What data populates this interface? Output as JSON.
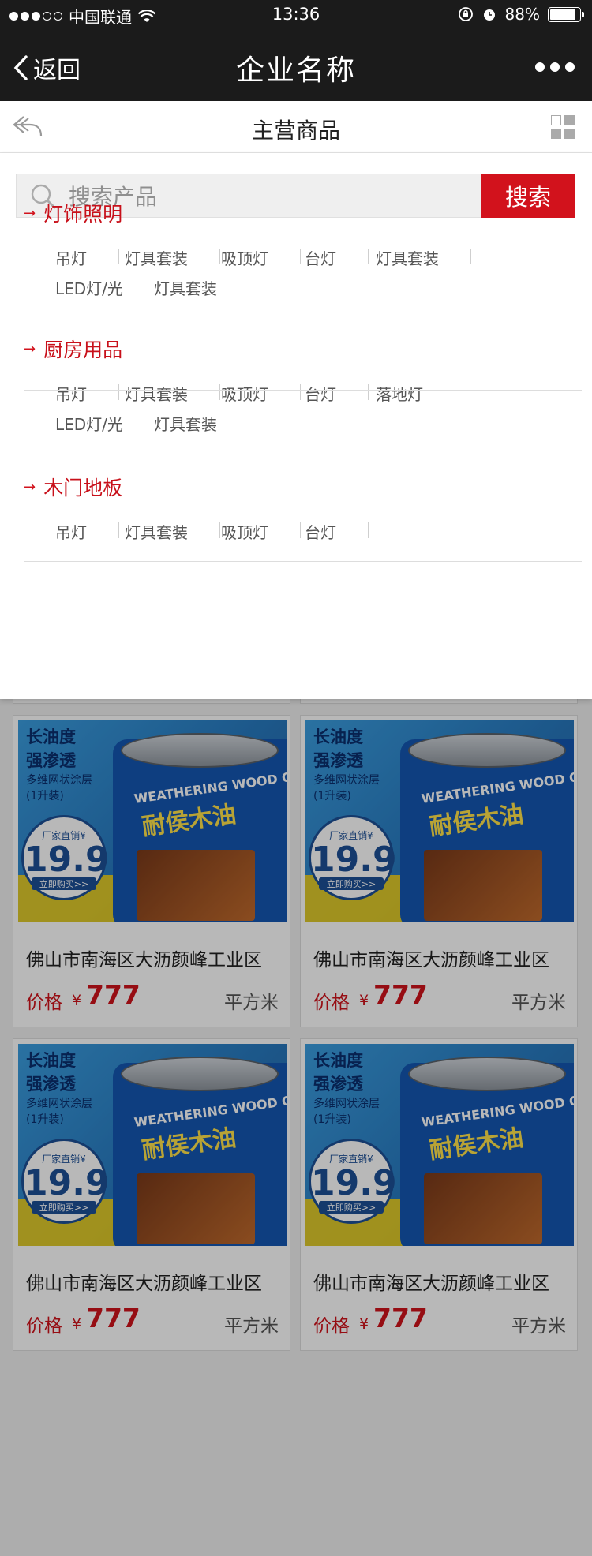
{
  "status_bar": {
    "carrier": "中国联通",
    "time": "13:36",
    "battery": "88%",
    "battery_level": 0.88,
    "signal_dots": 5,
    "signal_filled": 3
  },
  "nav": {
    "back_label": "返回",
    "title": "企业名称"
  },
  "subheader": {
    "title": "主营商品"
  },
  "search": {
    "placeholder": "搜索产品",
    "button_label": "搜索"
  },
  "categories": [
    {
      "title": "灯饰照明",
      "tags": [
        "吊灯",
        "灯具套装",
        "吸顶灯",
        "台灯",
        "灯具套装",
        "LED灯/光",
        "灯具套装"
      ]
    },
    {
      "title": "厨房用品",
      "tags": [
        "吊灯",
        "灯具套装",
        "吸顶灯",
        "台灯",
        "落地灯",
        "LED灯/光",
        "灯具套装"
      ]
    },
    {
      "title": "木门地板",
      "tags": [
        "吊灯",
        "灯具套装",
        "吸顶灯",
        "台灯"
      ]
    }
  ],
  "product_image": {
    "headline_1": "长油度",
    "headline_2": "强渗透",
    "sub_1": "多维网状涂层",
    "sub_2": "(1升装)",
    "circle_top": "厂家直销¥",
    "circle_num": "19.9",
    "circle_bottom": "立即购买>>",
    "brand": "WEATHERING WOOD O",
    "product_name": "耐侯木油"
  },
  "products": [
    {
      "name": "佛山市南海区大沥颜峰工业区",
      "price_label": "价格",
      "currency": "¥",
      "price": "777",
      "unit": "平方米"
    },
    {
      "name": "佛山市南海区大沥颜峰工业区",
      "price_label": "价格",
      "currency": "¥",
      "price": "777",
      "unit": "平方米"
    },
    {
      "name": "佛山市南海区大沥颜峰工业区",
      "price_label": "价格",
      "currency": "¥",
      "price": "777",
      "unit": "平方米"
    },
    {
      "name": "佛山市南海区大沥颜峰工业区",
      "price_label": "价格",
      "currency": "¥",
      "price": "777",
      "unit": "平方米"
    },
    {
      "name": "佛山市南海区大沥颜峰工业区",
      "price_label": "价格",
      "currency": "¥",
      "price": "777",
      "unit": "平方米"
    },
    {
      "name": "佛山市南海区大沥颜峰工业区",
      "price_label": "价格",
      "currency": "¥",
      "price": "777",
      "unit": "平方米"
    }
  ],
  "colors": {
    "accent": "#d2121c",
    "header_bg": "#1b1b1b"
  }
}
